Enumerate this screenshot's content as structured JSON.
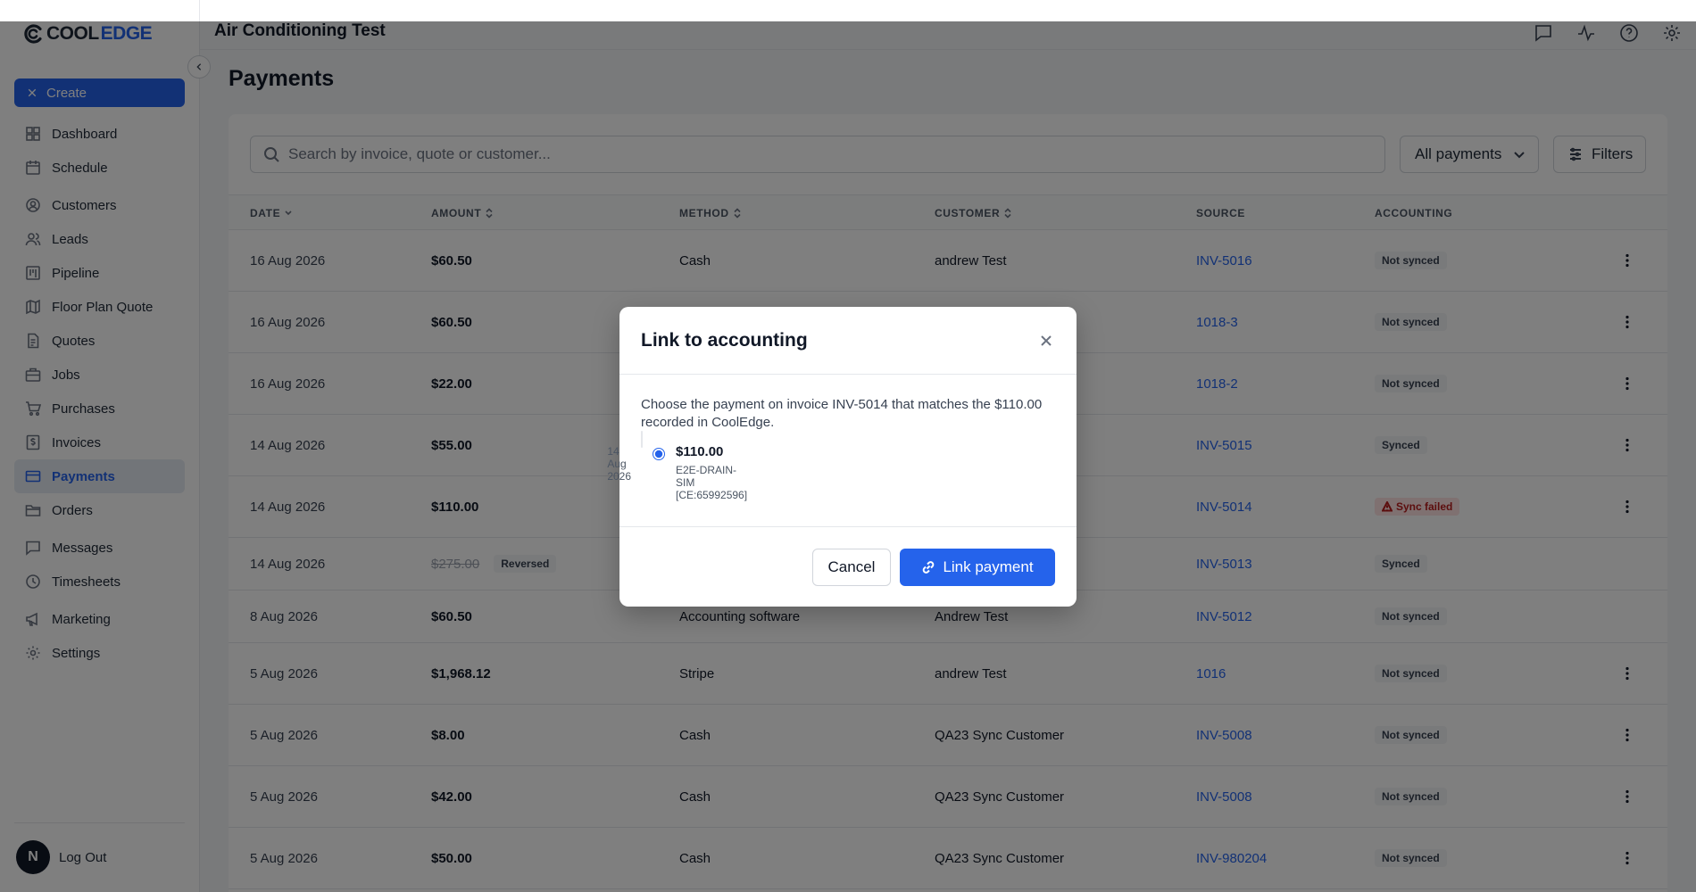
{
  "app": {
    "logo_cool": "COOL",
    "logo_edge": "EDGE",
    "title": "Air Conditioning Test"
  },
  "sidebar": {
    "create_label": "Create",
    "items": [
      {
        "label": "Dashboard",
        "icon": "dashboard-icon"
      },
      {
        "label": "Schedule",
        "icon": "calendar-icon"
      },
      {
        "label": "Customers",
        "icon": "user-circle-icon"
      },
      {
        "label": "Leads",
        "icon": "users-icon"
      },
      {
        "label": "Pipeline",
        "icon": "pipeline-icon"
      },
      {
        "label": "Floor Plan Quote",
        "icon": "map-icon"
      },
      {
        "label": "Quotes",
        "icon": "document-icon"
      },
      {
        "label": "Jobs",
        "icon": "briefcase-icon"
      },
      {
        "label": "Purchases",
        "icon": "cart-icon"
      },
      {
        "label": "Invoices",
        "icon": "dollar-doc-icon"
      },
      {
        "label": "Payments",
        "icon": "credit-card-icon",
        "active": true
      },
      {
        "label": "Orders",
        "icon": "folder-icon"
      },
      {
        "label": "Messages",
        "icon": "message-icon"
      },
      {
        "label": "Timesheets",
        "icon": "clock-icon"
      },
      {
        "label": "Marketing",
        "icon": "megaphone-icon"
      },
      {
        "label": "Settings",
        "icon": "gear-icon"
      }
    ],
    "avatar_initial": "N",
    "logout_label": "Log Out"
  },
  "page": {
    "title": "Payments",
    "search_placeholder": "Search by invoice, quote or customer...",
    "filter_select": "All payments",
    "filters_label": "Filters"
  },
  "table": {
    "headers": {
      "date": "DATE",
      "amount": "AMOUNT",
      "method": "METHOD",
      "customer": "CUSTOMER",
      "source": "SOURCE",
      "accounting": "ACCOUNTING"
    },
    "rows": [
      {
        "date": "16 Aug 2026",
        "amount": "$60.50",
        "method": "Cash",
        "customer": "andrew Test",
        "source": "INV-5016",
        "status": "Not synced"
      },
      {
        "date": "16 Aug 2026",
        "amount": "$60.50",
        "method": "",
        "customer": "",
        "source": "1018-3",
        "status": "Not synced"
      },
      {
        "date": "16 Aug 2026",
        "amount": "$22.00",
        "method": "",
        "customer": "",
        "source": "1018-2",
        "status": "Not synced"
      },
      {
        "date": "14 Aug 2026",
        "amount": "$55.00",
        "method": "",
        "customer": "",
        "source": "INV-5015",
        "status": "Synced"
      },
      {
        "date": "14 Aug 2026",
        "amount": "$110.00",
        "method": "",
        "customer": "",
        "source": "INV-5014",
        "status": "Sync failed"
      },
      {
        "date": "14 Aug 2026",
        "amount": "$275.00",
        "reversed": "Reversed",
        "method": "",
        "customer": "",
        "source": "INV-5013",
        "status": "Synced"
      },
      {
        "date": "8 Aug 2026",
        "amount": "$60.50",
        "method": "Accounting software",
        "customer": "Andrew Test",
        "source": "INV-5012",
        "status": "Not synced"
      },
      {
        "date": "5 Aug 2026",
        "amount": "$1,968.12",
        "method": "Stripe",
        "customer": "andrew Test",
        "source": "1016",
        "status": "Not synced"
      },
      {
        "date": "5 Aug 2026",
        "amount": "$8.00",
        "method": "Cash",
        "customer": "QA23 Sync Customer",
        "source": "INV-5008",
        "status": "Not synced"
      },
      {
        "date": "5 Aug 2026",
        "amount": "$42.00",
        "method": "Cash",
        "customer": "QA23 Sync Customer",
        "source": "INV-5008",
        "status": "Not synced"
      },
      {
        "date": "5 Aug 2026",
        "amount": "$50.00",
        "method": "Cash",
        "customer": "QA23 Sync Customer",
        "source": "INV-980204",
        "status": "Not synced"
      }
    ]
  },
  "modal": {
    "title": "Link to accounting",
    "description": "Choose the payment on invoice INV-5014 that matches the $110.00 recorded in CoolEdge.",
    "option": {
      "amount": "$110.00",
      "reference": "E2E-DRAIN-SIM [CE:65992596]",
      "date": "14 Aug 2026",
      "selected": true
    },
    "cancel_label": "Cancel",
    "link_label": "Link payment"
  },
  "colors": {
    "accent": "#2563eb",
    "failed": "#b91c1c"
  }
}
